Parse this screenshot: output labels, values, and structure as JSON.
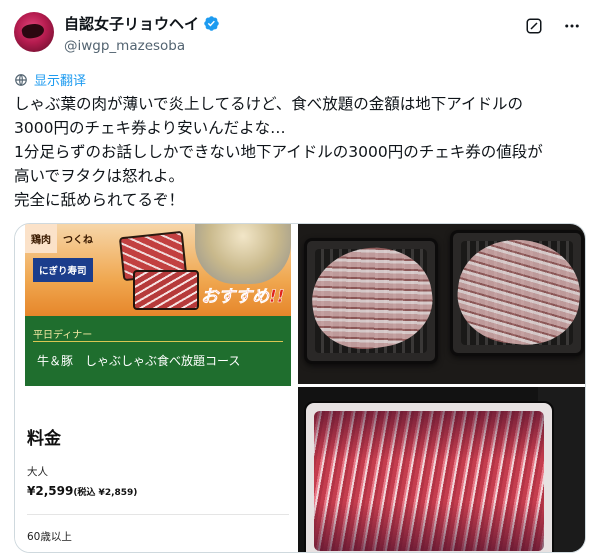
{
  "tweet": {
    "display_name": "自認女子リョウヘイ",
    "handle": "@iwgp_mazesoba",
    "translate_label": "显示翻译",
    "lines": [
      "しゃぶ葉の肉が薄いで炎上してるけど、食べ放題の金額は地下アイドルの",
      "3000円のチェキ券より安いんだよな…",
      "1分足らずのお話ししかできない地下アイドルの3000円のチェキ券の値段が",
      "高いでヲタクは怒れよ。",
      "完全に舐められてるぞ！"
    ]
  },
  "media": {
    "card": {
      "tab1": "鶏肉",
      "tab2": "つくね",
      "nigiri_label": "にぎり寿司",
      "osusume": "おすすめ!!",
      "subtitle": "平日ディナー",
      "course_title": "牛＆豚　しゃぶしゃぶ食べ放題コース",
      "fee_title": "料金",
      "adult_label": "大人",
      "adult_price": "¥2,599",
      "adult_price_tax": "(税込 ¥2,859)",
      "senior_label": "60歳以上"
    }
  },
  "colors": {
    "accent": "#1d9bf0",
    "verified": "#1d9bf0",
    "card_green": "#1f6e2e",
    "osusume_red": "#e0231b"
  },
  "icons": {
    "verified": "verified-badge-icon",
    "grok": "grok-icon",
    "more": "more-dots-icon",
    "translate": "translate-globe-icon"
  }
}
